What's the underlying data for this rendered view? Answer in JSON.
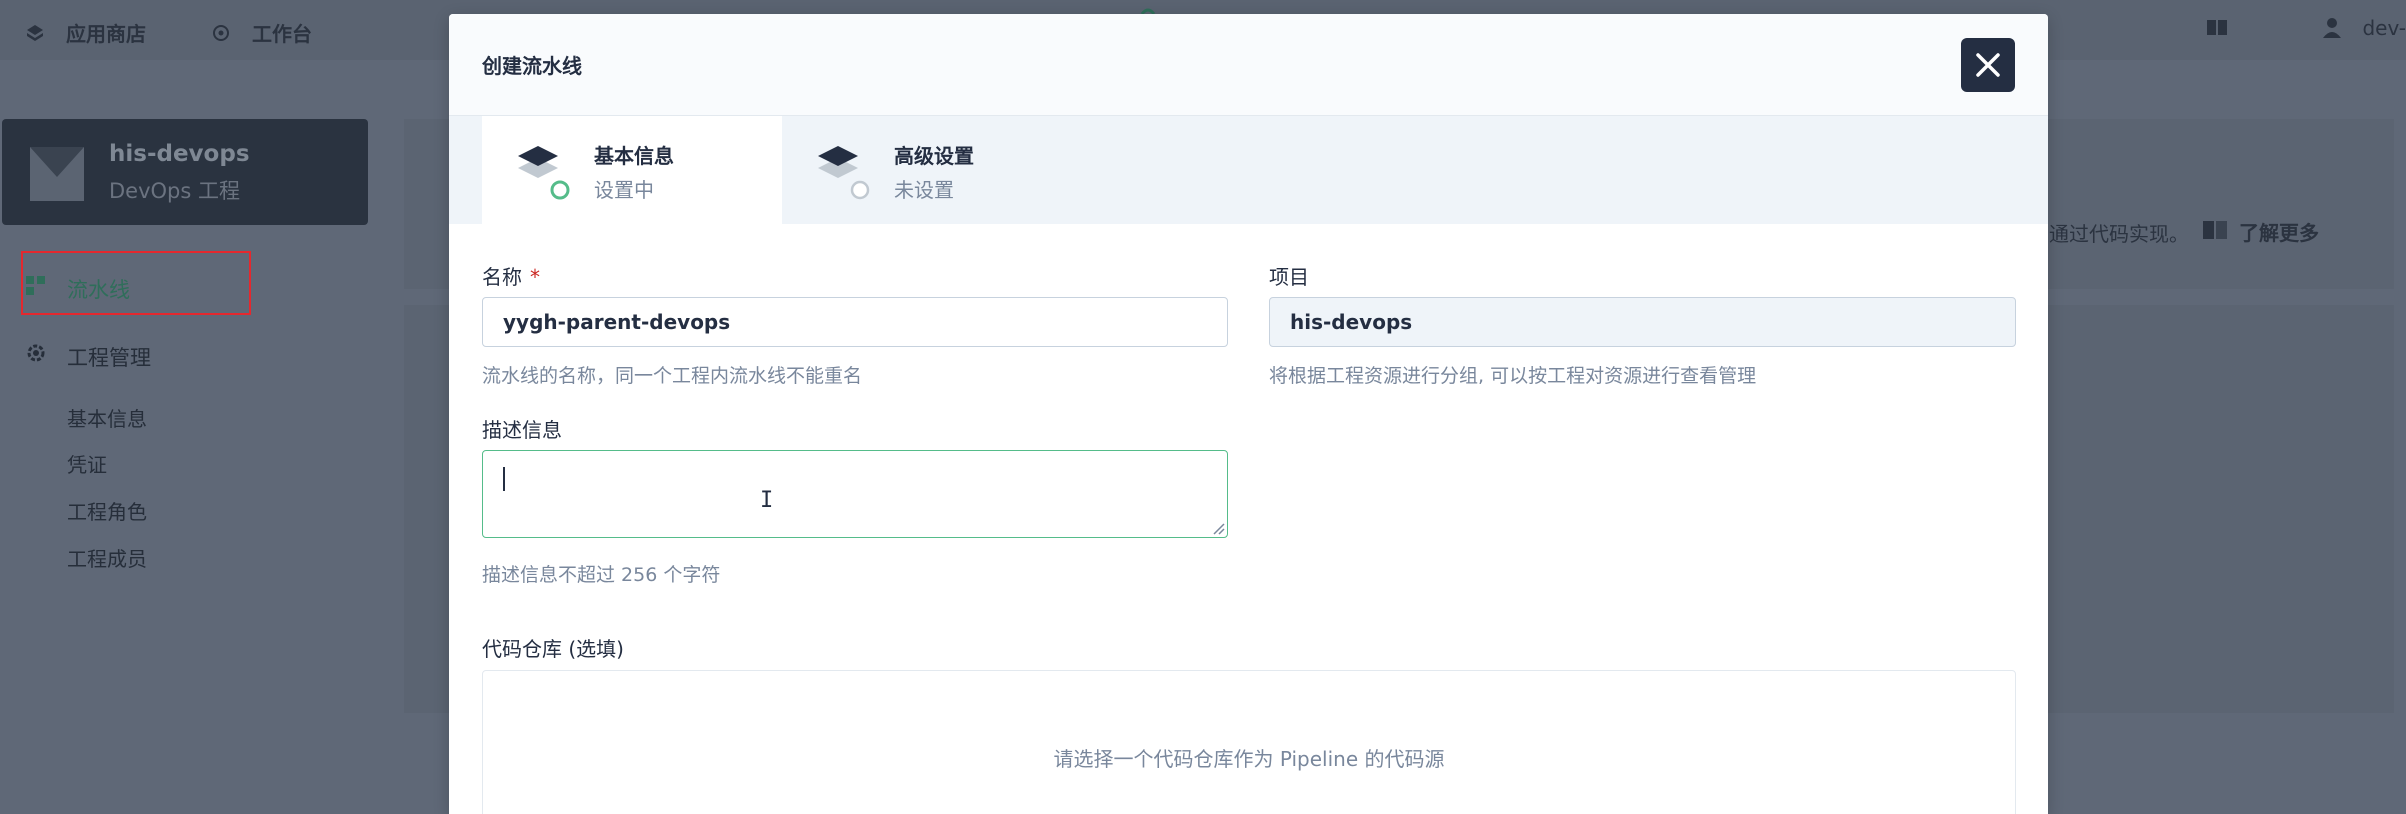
{
  "topbar": {
    "app_store": "应用商店",
    "workbench": "工作台",
    "user": "dev-"
  },
  "workspace": {
    "name": "his-devops",
    "subtitle": "DevOps 工程"
  },
  "sidebar": {
    "pipelines": "流水线",
    "project_mgmt": "工程管理",
    "sub_items": [
      "基本信息",
      "凭证",
      "工程角色",
      "工程成员"
    ]
  },
  "background": {
    "desc_tail": "通过代码实现。",
    "learn_more": "了解更多"
  },
  "modal": {
    "title": "创建流水线",
    "steps": [
      {
        "title": "基本信息",
        "status": "设置中"
      },
      {
        "title": "高级设置",
        "status": "未设置"
      }
    ],
    "name_label": "名称",
    "required_mark": "*",
    "name_value": "yygh-parent-devops",
    "name_hint": "流水线的名称，同一个工程内流水线不能重名",
    "project_label": "项目",
    "project_value": "his-devops",
    "project_hint": "将根据工程资源进行分组, 可以按工程对资源进行查看管理",
    "desc_label": "描述信息",
    "desc_value": "",
    "desc_hint": "描述信息不超过 256 个字符",
    "repo_label": "代码仓库 (选填)",
    "repo_placeholder": "请选择一个代码仓库作为 Pipeline 的代码源"
  },
  "colors": {
    "primary_dark": "#242e42",
    "accent_green": "#55bc8a",
    "required_red": "#ca2621",
    "highlight_box": "#e5282e"
  }
}
